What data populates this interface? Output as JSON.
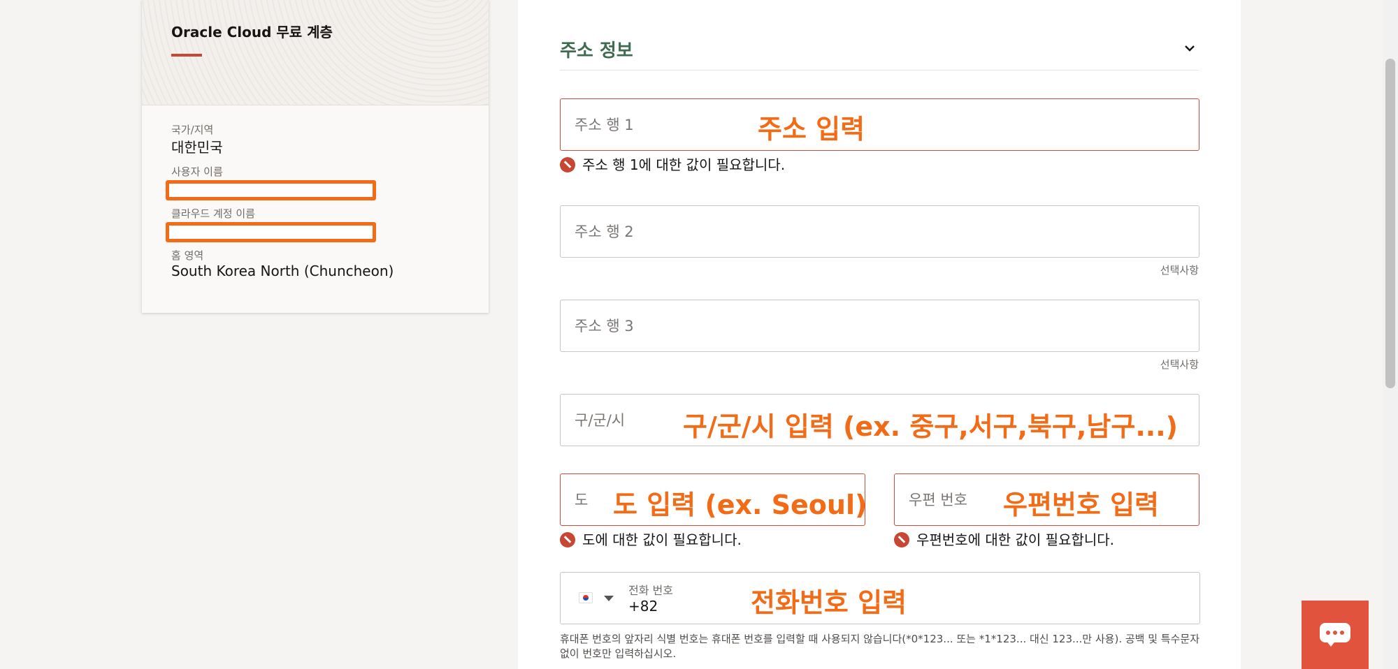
{
  "summary": {
    "title": "Oracle Cloud 무료 계층",
    "country_label": "국가/지역",
    "country_value": "대한민국",
    "username_label": "사용자 이름",
    "cloud_account_label": "클라우드 계정 이름",
    "home_region_label": "홈 영역",
    "home_region_value": "South Korea North (Chuncheon)"
  },
  "form": {
    "section_title": "주소 정보",
    "address1": {
      "placeholder": "주소 행 1",
      "value": "",
      "error": "주소 행 1에 대한 값이 필요합니다."
    },
    "address2": {
      "placeholder": "주소 행 2",
      "value": "",
      "hint": "선택사항"
    },
    "address3": {
      "placeholder": "주소 행 3",
      "value": "",
      "hint": "선택사항"
    },
    "city": {
      "placeholder": "구/군/시",
      "value": ""
    },
    "province": {
      "placeholder": "도",
      "value": "",
      "error": "도에 대한 값이 필요합니다."
    },
    "postal": {
      "placeholder": "우편 번호",
      "value": "",
      "error": "우편번호에 대한 값이 필요합니다."
    },
    "phone": {
      "label": "전화 번호",
      "value": "+82",
      "note": "휴대폰 번호의 앞자리 식별 번호는 휴대폰 번호를 입력할 때 사용되지 않습니다(*0*123... 또는 *1*123... 대신 123...만 사용). 공백 및 특수문자 없이 번호만 입력하십시오."
    }
  },
  "annotations": {
    "address": "주소 입력",
    "city": "구/군/시 입력 (ex. 중구,서구,북구,남구...)",
    "province": "도 입력 (ex. Seoul)",
    "postal": "우편번호 입력",
    "phone": "전화번호 입력"
  },
  "colors": {
    "brand_red": "#c74634",
    "section_green": "#3f6b4f",
    "annotation_orange": "#f26b16",
    "chat_button": "#e2533e"
  },
  "icons": [
    "chevron-down-icon",
    "error-icon",
    "korea-flag-icon",
    "caret-down-icon",
    "chat-icon"
  ]
}
